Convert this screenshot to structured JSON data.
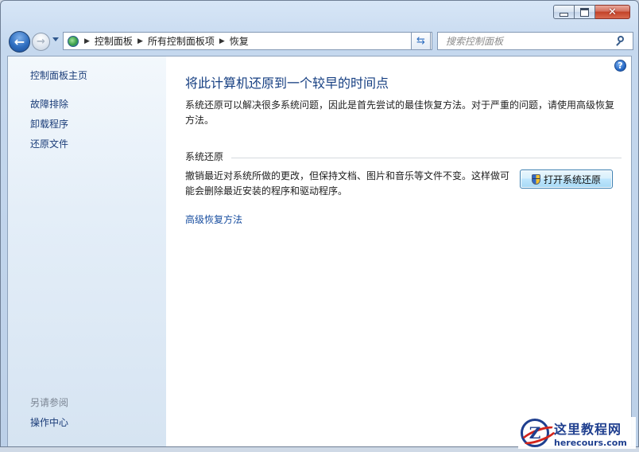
{
  "window": {
    "caption": {
      "minimize": "minimize",
      "maximize": "maximize",
      "close": "close"
    }
  },
  "nav": {
    "breadcrumbs": [
      "控制面板",
      "所有控制面板项",
      "恢复"
    ],
    "search_placeholder": "搜索控制面板"
  },
  "sidebar": {
    "home": "控制面板主页",
    "links": [
      "故障排除",
      "卸载程序",
      "还原文件"
    ],
    "see_also_label": "另请参阅",
    "see_also_links": [
      "操作中心"
    ]
  },
  "main": {
    "title": "将此计算机还原到一个较早的时间点",
    "description": "系统还原可以解决很多系统问题，因此是首先尝试的最佳恢复方法。对于严重的问题，请使用高级恢复方法。",
    "section_title": "系统还原",
    "restore_description": "撤销最近对系统所做的更改，但保持文档、图片和音乐等文件不变。这样做可能会删除最近安装的程序和驱动程序。",
    "restore_button": "打开系统还原",
    "advanced_link": "高级恢复方法"
  },
  "watermark": {
    "logo_letter": "Z",
    "name": "这里教程网",
    "url": "herecours.com"
  }
}
